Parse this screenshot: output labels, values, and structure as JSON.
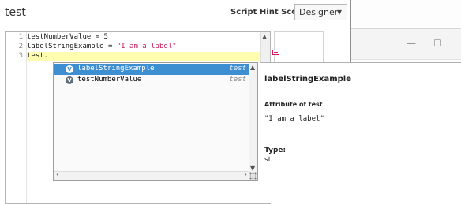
{
  "dialog": {
    "title": "test"
  },
  "header": {
    "hint_label": "Script Hint Scope",
    "scope_value": "Designer"
  },
  "editor": {
    "line_numbers": [
      "1",
      "2",
      "3"
    ],
    "line1": "testNumberValue = 5",
    "line2_prefix": "labelStringExample = ",
    "line2_string": "\"I am a label\"",
    "line3": "test."
  },
  "autocomplete": {
    "items": [
      {
        "badge": "V",
        "name": "labelStringExample",
        "type": "test"
      },
      {
        "badge": "V",
        "name": "testNumberValue",
        "type": "test"
      }
    ]
  },
  "doc_panel": {
    "title": "labelStringExample",
    "attribute": "Attribute of test",
    "value": "\"I am a label\"",
    "type_label": "Type:",
    "type_value": "str"
  },
  "background_window": {
    "minimize": "—",
    "maximize": "☐"
  },
  "colors": {
    "selection": "#3d8fd1",
    "string": "#c2185b",
    "current_line": "#fffeb0"
  }
}
